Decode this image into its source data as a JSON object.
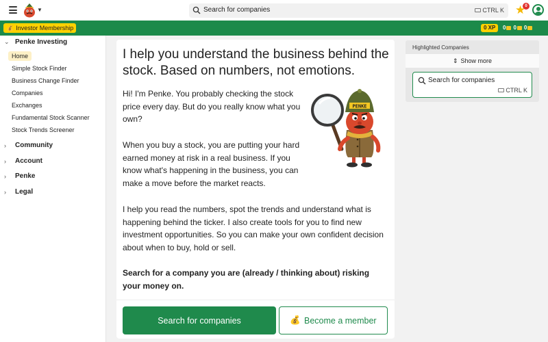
{
  "topbar": {
    "search_placeholder": "Search for companies",
    "shortcut": "CTRL K",
    "notifications_count": "0"
  },
  "greenbar": {
    "membership_label": "Investor Membership",
    "xp": "0 XP",
    "coins": [
      "0",
      "0",
      "0"
    ]
  },
  "sidebar": {
    "groups": [
      {
        "label": "Penke Investing",
        "expanded": true
      },
      {
        "label": "Community"
      },
      {
        "label": "Account"
      },
      {
        "label": "Penke"
      },
      {
        "label": "Legal"
      }
    ],
    "items": [
      {
        "label": "Home",
        "active": true
      },
      {
        "label": "Simple Stock Finder"
      },
      {
        "label": "Business Change Finder"
      },
      {
        "label": "Companies"
      },
      {
        "label": "Exchanges"
      },
      {
        "label": "Fundamental Stock Scanner"
      },
      {
        "label": "Stock Trends Screener"
      }
    ]
  },
  "main": {
    "headline": "I help you understand the business behind the stock. Based on numbers, not emotions.",
    "paragraphs": [
      "Hi! I'm Penke. You probably checking the stock price every day. But do you really know what you own?",
      "When you buy a stock, you are putting your hard earned money at risk in a real business. If you know what's happening in the business, you can make a move before the market reacts.",
      "I help you read the numbers, spot the trends and understand what is happening behind the ticker. I also create tools for you to find new investment opportunities. So you can make your own confident decision about when to buy, hold or sell.",
      "Search for a company you are (already / thinking about) risking your money on."
    ],
    "mascot_badge": "PENKE",
    "primary_button": "Search for companies",
    "secondary_button": "Become a member"
  },
  "right_panel": {
    "title": "Highlighted Companies",
    "show_more": "Show more",
    "search_placeholder": "Search for companies",
    "shortcut": "CTRL K"
  },
  "colors": {
    "brand_green": "#1c8a4a",
    "accent_yellow": "#ffd100",
    "active_item_bg": "#fdf0c6"
  }
}
